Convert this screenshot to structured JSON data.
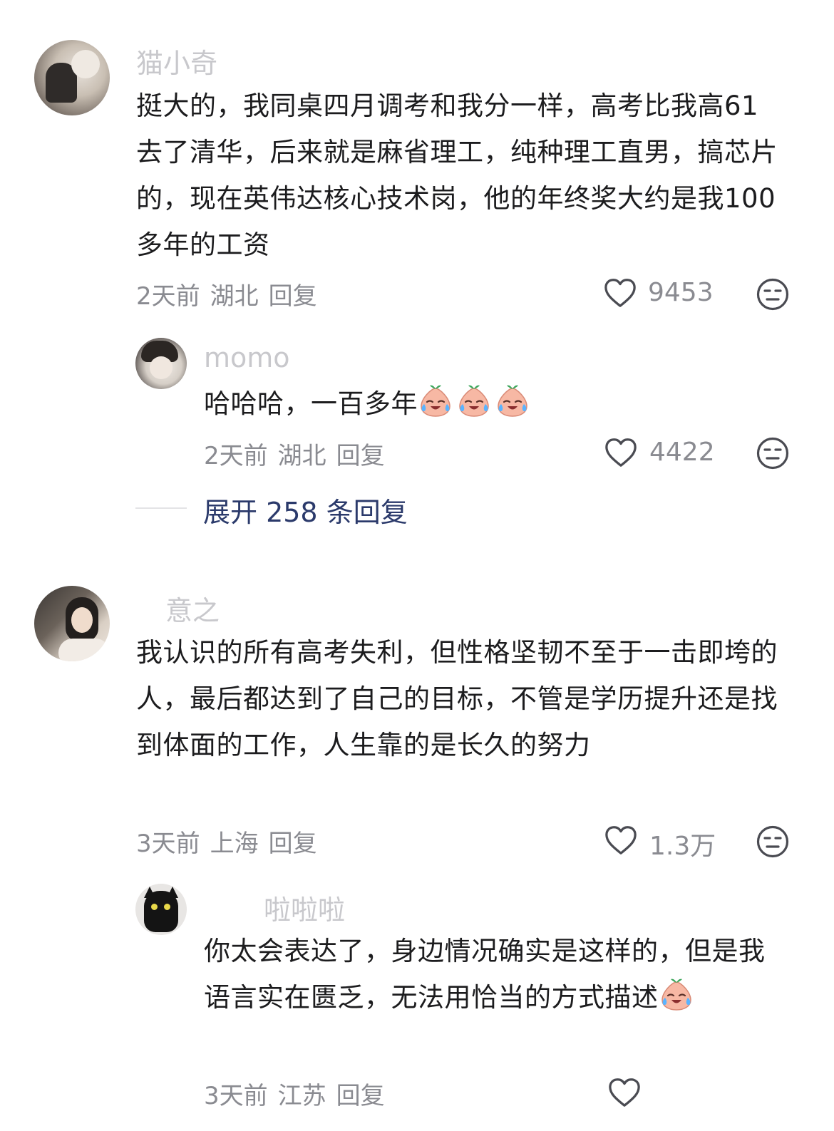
{
  "comments": [
    {
      "username": "猫小奇",
      "text": "挺大的，我同桌四月调考和我分一样，高考比我高61去了清华，后来就是麻省理工，纯种理工直男，搞芯片的，现在英伟达核心技术岗，他的年终奖大约是我100多年的工资",
      "time": "2天前",
      "location": "湖北",
      "reply_label": "回复",
      "likes": "9453",
      "reply": {
        "username": "momo",
        "text": "哈哈哈，一百多年",
        "emojis": [
          "crying-laughing-peach",
          "crying-laughing-peach",
          "crying-laughing-peach"
        ],
        "time": "2天前",
        "location": "湖北",
        "reply_label": "回复",
        "likes": "4422"
      },
      "expand_label": "展开 258 条回复"
    },
    {
      "username": "意之",
      "text": "我认识的所有高考失利，但性格坚韧不至于一击即垮的人，最后都达到了自己的目标，不管是学历提升还是找到体面的工作，人生靠的是长久的努力",
      "time": "3天前",
      "location": "上海",
      "reply_label": "回复",
      "likes": "1.3万",
      "reply": {
        "username": "啦啦啦",
        "text": "你太会表达了，身边情况确实是这样的，但是我语言实在匮乏，无法用恰当的方式描述",
        "emojis": [
          "crying-laughing-peach"
        ],
        "time": "3天前",
        "location": "江苏",
        "reply_label": "回复"
      }
    }
  ],
  "icons": {
    "like": "heart-outline-icon",
    "dislike": "neutral-face-icon"
  },
  "colors": {
    "username": "#c8c8cc",
    "text": "#1c1c1e",
    "meta": "#8a8b91",
    "expand": "#2b3a6b"
  }
}
